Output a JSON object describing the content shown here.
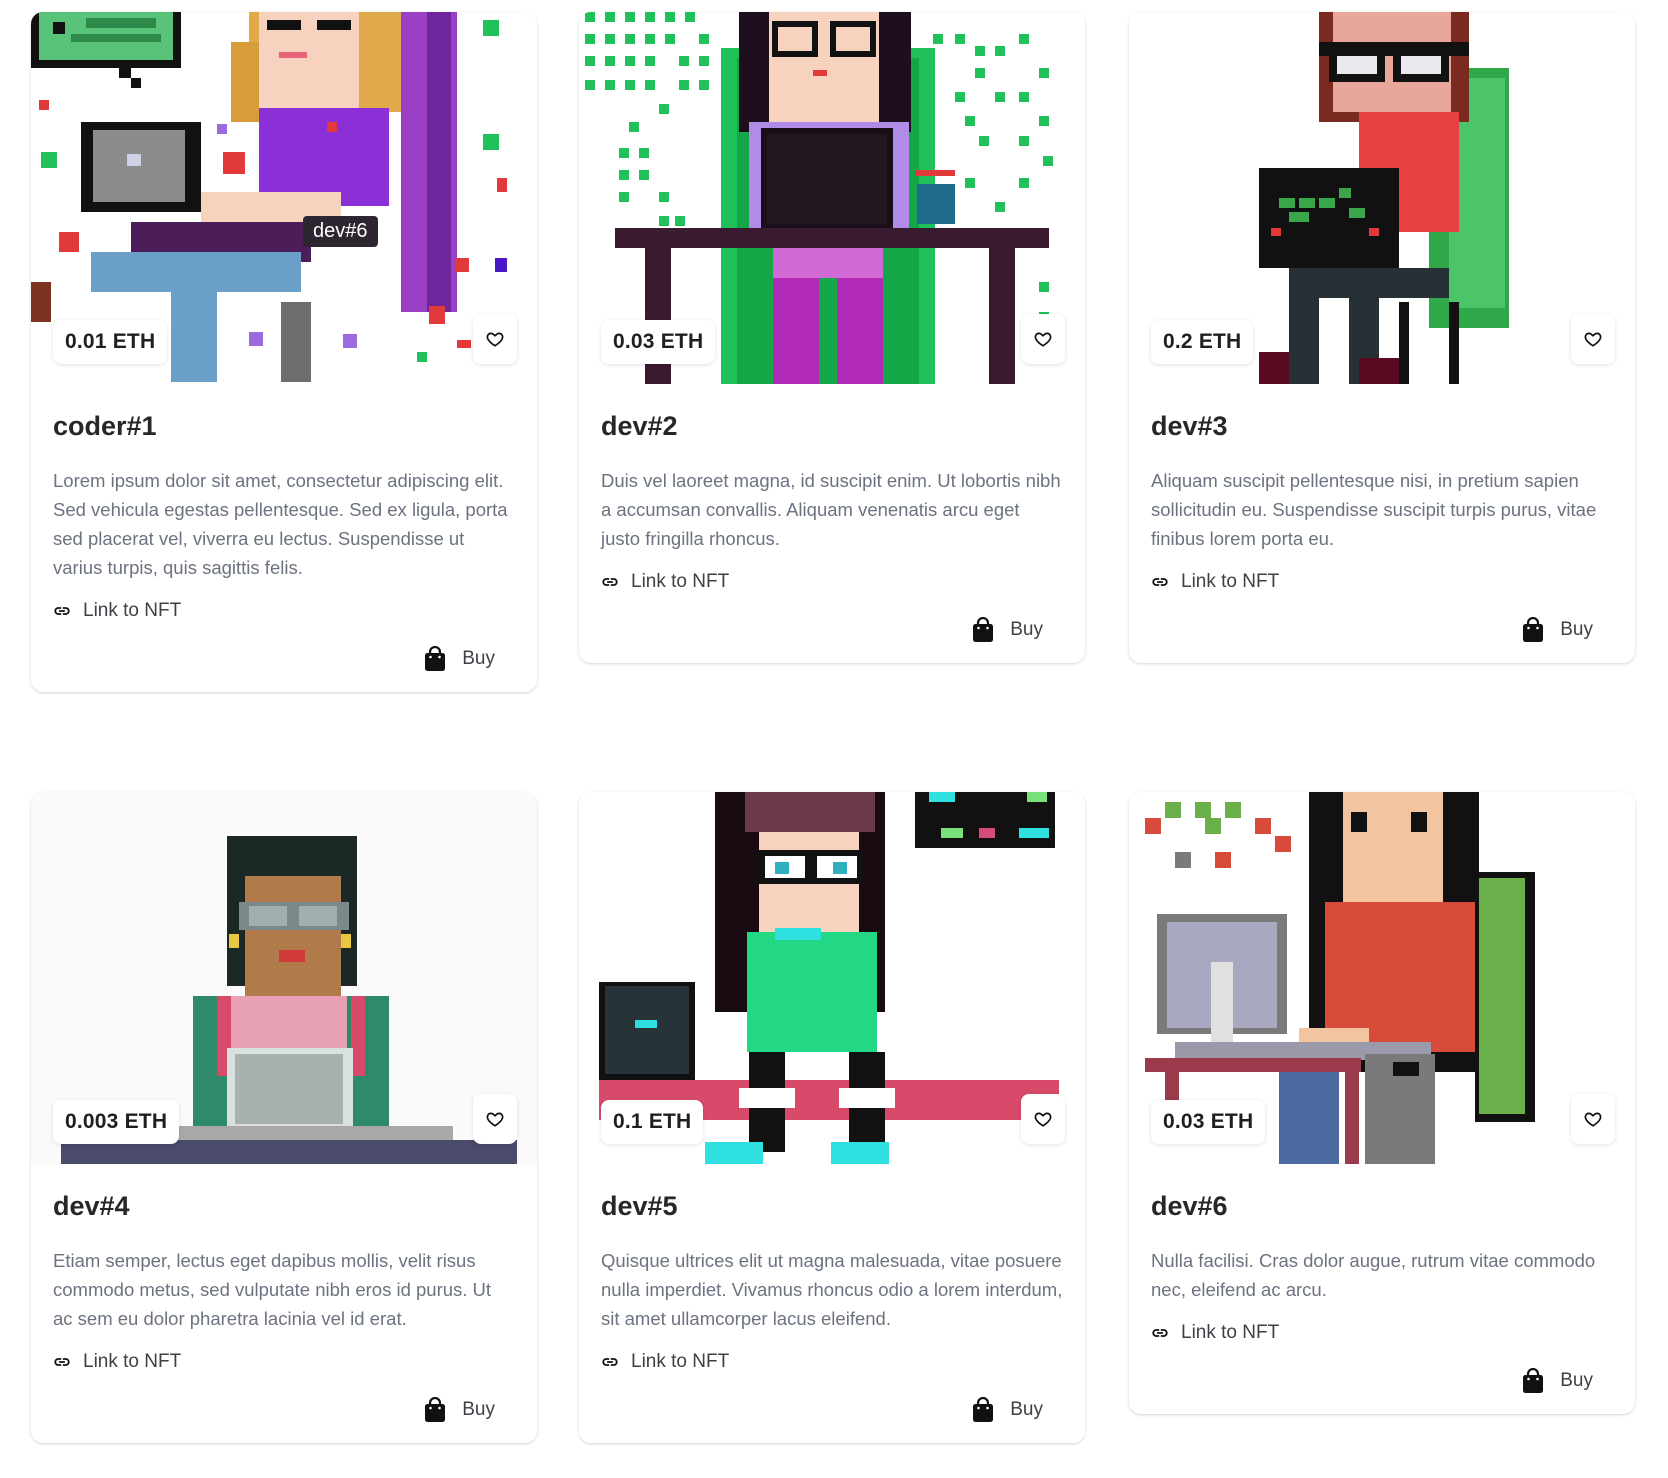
{
  "cards": [
    {
      "price": "0.01 ETH",
      "title": "coder#1",
      "description": "Lorem ipsum dolor sit amet, consectetur adipiscing elit. Sed vehicula egestas pellentesque. Sed ex ligula, porta sed placerat vel, viverra eu lectus. Suspendisse ut varius turpis, quis sagittis felis.",
      "link_label": "Link to NFT",
      "buy_label": "Buy",
      "image_caption": "dev#6"
    },
    {
      "price": "0.03 ETH",
      "title": "dev#2",
      "description": "Duis vel laoreet magna, id suscipit enim. Ut lobortis nibh a accumsan convallis. Aliquam venenatis arcu eget justo fringilla rhoncus.",
      "link_label": "Link to NFT",
      "buy_label": "Buy"
    },
    {
      "price": "0.2 ETH",
      "title": "dev#3",
      "description": "Aliquam suscipit pellentesque nisi, in pretium sapien sollicitudin eu. Suspendisse suscipit turpis purus, vitae finibus lorem porta eu.",
      "link_label": "Link to NFT",
      "buy_label": "Buy"
    },
    {
      "price": "0.003 ETH",
      "title": "dev#4",
      "description": "Etiam semper, lectus eget dapibus mollis, velit risus commodo metus, sed vulputate nibh eros id purus. Ut ac sem eu dolor pharetra lacinia vel id erat.",
      "link_label": "Link to NFT",
      "buy_label": "Buy"
    },
    {
      "price": "0.1 ETH",
      "title": "dev#5",
      "description": "Quisque ultrices elit ut magna malesuada, vitae posuere nulla imperdiet. Vivamus rhoncus odio a lorem interdum, sit amet ullamcorper lacus eleifend.",
      "link_label": "Link to NFT",
      "buy_label": "Buy"
    },
    {
      "price": "0.03 ETH",
      "title": "dev#6",
      "description": "Nulla facilisi. Cras dolor augue, rutrum vitae commodo nec, eleifend ac arcu.",
      "link_label": "Link to NFT",
      "buy_label": "Buy"
    }
  ],
  "icons": {
    "favorite": "heart-outline-icon",
    "link": "link-icon",
    "buy": "shopping-bag-icon"
  },
  "colors": {
    "title": "#27272a",
    "description": "#6b7280",
    "text": "#3f3f46"
  }
}
